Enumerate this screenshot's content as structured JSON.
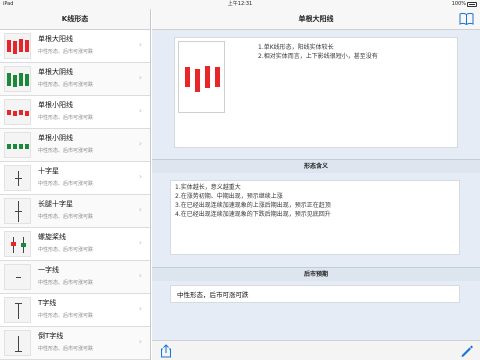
{
  "status_bar": {
    "carrier": "iPad",
    "time": "上午12:31",
    "battery": "100%"
  },
  "sidebar": {
    "title": "K线形态",
    "items": [
      {
        "title": "单根大阳线",
        "subtitle": "中性形态、后市可涨可跌",
        "icon": "big-yang-candle-icon",
        "selected": true
      },
      {
        "title": "单根大阴线",
        "subtitle": "中性形态、后市可涨可跌",
        "icon": "big-yin-candle-icon"
      },
      {
        "title": "单根小阳线",
        "subtitle": "中性形态、后市可涨可跌",
        "icon": "small-yang-candle-icon"
      },
      {
        "title": "单根小阴线",
        "subtitle": "中性形态、后市可涨可跌",
        "icon": "small-yin-candle-icon"
      },
      {
        "title": "十字星",
        "subtitle": "中性形态、后市可涨可跌",
        "icon": "doji-icon"
      },
      {
        "title": "长腿十字星",
        "subtitle": "中性形态、后市可涨可跌",
        "icon": "long-legged-doji-icon"
      },
      {
        "title": "螺旋桨线",
        "subtitle": "中性形态、后市可涨可跌",
        "icon": "spinning-top-icon"
      },
      {
        "title": "一字线",
        "subtitle": "中性形态、后市可涨可跌",
        "icon": "flat-line-icon"
      },
      {
        "title": "T字线",
        "subtitle": "中性形态、后市可涨可跌",
        "icon": "t-line-icon"
      },
      {
        "title": "倒T字线",
        "subtitle": "中性形态、后市可涨可跌",
        "icon": "inverted-t-line-icon"
      }
    ]
  },
  "main": {
    "title": "单根大阳线",
    "overview_lines": [
      "1.单K线形态，阳线实体较长",
      "2.相对实体而言，上下影线很短小，甚至没有"
    ],
    "meaning_title": "形态含义",
    "meaning_lines": [
      "1.实体越长，意义越重大",
      "2.在涨势初期、中期出现，预示继续上涨",
      "3.在已经出现连续加速现象的上涨后期出现，预示正在赶顶",
      "4.在已经出现连续加速现象的下跌后期出现，预示见底回升"
    ],
    "forecast_title": "后市预期",
    "forecast_text": "中性形态，后市可涨可跌"
  },
  "colors": {
    "up": "#e8262a",
    "down": "#1a8a3a",
    "accent": "#1a73d9"
  }
}
